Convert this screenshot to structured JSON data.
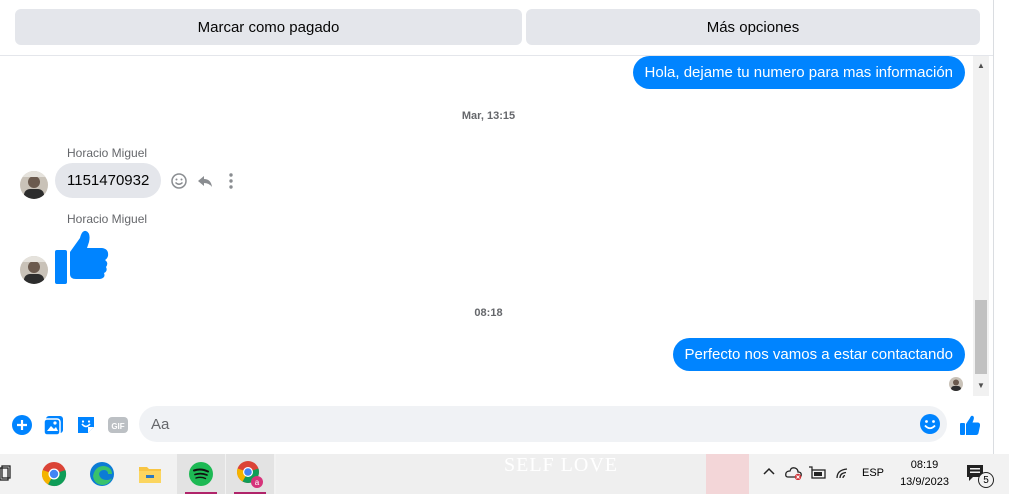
{
  "actions": {
    "mark_paid": "Marcar como pagado",
    "more_options": "Más opciones"
  },
  "thread": {
    "messages": [
      {
        "type": "outgoing",
        "text": "Hola, dejame tu numero para mas información"
      },
      {
        "type": "timestamp",
        "text": "Mar, 13:15"
      },
      {
        "type": "incoming",
        "sender": "Horacio Miguel",
        "text": "1151470932"
      },
      {
        "type": "incoming-like",
        "sender": "Horacio Miguel"
      },
      {
        "type": "timestamp",
        "text": "08:18"
      },
      {
        "type": "outgoing",
        "text": "Perfecto  nos vamos a estar contactando"
      }
    ]
  },
  "composer": {
    "placeholder": "Aa"
  },
  "taskbar": {
    "apps": [
      "chrome-icon",
      "edge-icon",
      "file-explorer-icon",
      "spotify-icon",
      "chrome-profile-icon"
    ],
    "wallpaper_text": "SELF LOVE",
    "language": "ESP",
    "time": "08:19",
    "date": "13/9/2023",
    "notification_count": "5"
  },
  "colors": {
    "accent": "#0084ff",
    "incoming_bubble": "#e4e6eb",
    "taskbar_underline": "#b0246a"
  }
}
